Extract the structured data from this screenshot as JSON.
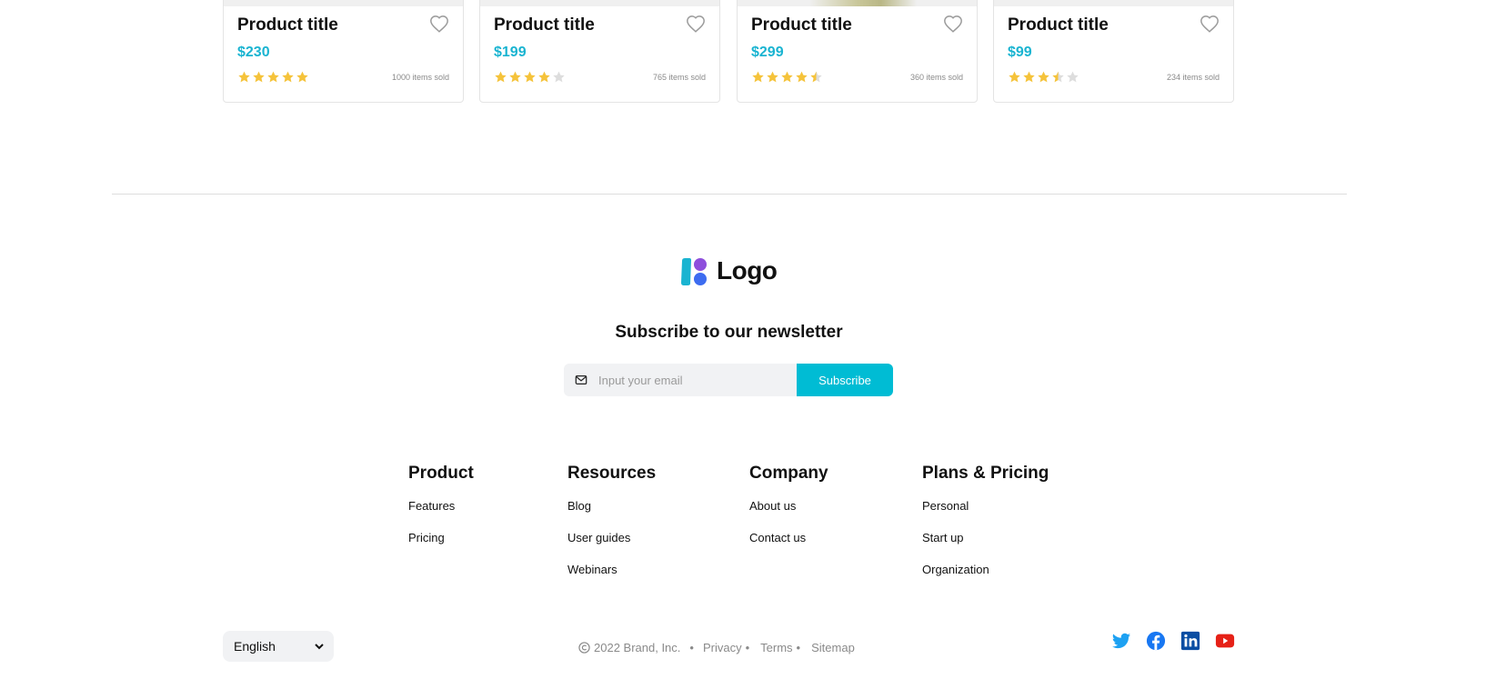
{
  "products": [
    {
      "title": "Product title",
      "price": "$230",
      "rating": 5,
      "sold": "1000 items sold"
    },
    {
      "title": "Product title",
      "price": "$199",
      "rating": 4,
      "sold": "765 items sold"
    },
    {
      "title": "Product title",
      "price": "$299",
      "rating": 4.5,
      "sold": "360 items sold"
    },
    {
      "title": "Product title",
      "price": "$99",
      "rating": 3.5,
      "sold": "234 items sold"
    }
  ],
  "logo": {
    "text": "Logo"
  },
  "newsletter": {
    "title": "Subscribe to our newsletter",
    "placeholder": "Input your email",
    "button": "Subscribe"
  },
  "footer": {
    "columns": [
      {
        "heading": "Product",
        "links": [
          "Features",
          "Pricing"
        ]
      },
      {
        "heading": "Resources",
        "links": [
          "Blog",
          "User guides",
          "Webinars"
        ]
      },
      {
        "heading": "Company",
        "links": [
          "About us",
          "Contact us"
        ]
      },
      {
        "heading": "Plans & Pricing",
        "links": [
          "Personal",
          "Start up",
          "Organization"
        ]
      }
    ]
  },
  "bottom": {
    "language": "English",
    "copyright": "2022 Brand, Inc.",
    "privacy": "Privacy",
    "terms": "Terms",
    "sitemap": "Sitemap",
    "bullet": "•"
  },
  "socials": [
    "twitter-icon",
    "facebook-icon",
    "linkedin-icon",
    "youtube-icon"
  ],
  "colors": {
    "accent": "#00bcd4",
    "price": "#1ab4d1",
    "star": "#f5c33b",
    "star_empty": "#dddddd",
    "twitter": "#1da1f2",
    "facebook": "#1877f2",
    "linkedin": "#0a66c2",
    "youtube": "#e62117"
  }
}
